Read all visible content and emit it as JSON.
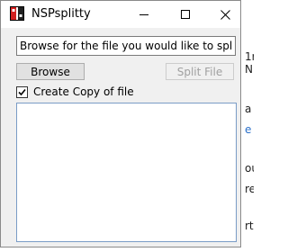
{
  "window": {
    "title": "NSPsplitty"
  },
  "form": {
    "path_value": "Browse for the file you would like to split",
    "browse_label": "Browse",
    "split_label": "Split File",
    "copy_label": "Create Copy of file",
    "copy_checked": true,
    "log_text": ""
  },
  "background": {
    "fragments": [
      "1r",
      "NE",
      "a",
      "e l",
      "ou",
      "re",
      "rt"
    ]
  }
}
